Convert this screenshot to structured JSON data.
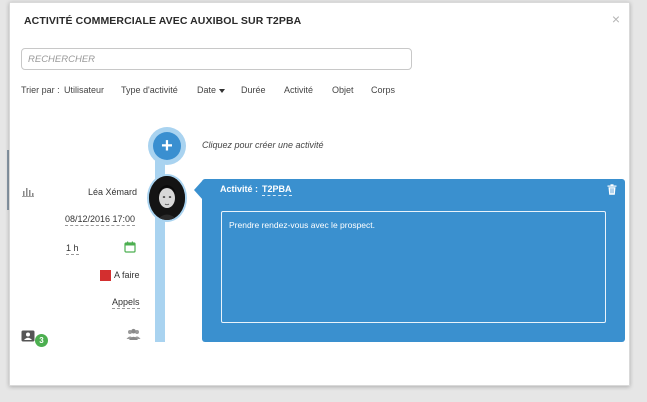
{
  "modal": {
    "title": "ACTIVITÉ COMMERCIALE AVEC AUXIBOL SUR T2PBA",
    "close_glyph": "×"
  },
  "search": {
    "placeholder": "RECHERCHER"
  },
  "sortbar": {
    "label": "Trier par :",
    "options": [
      "Utilisateur",
      "Type d'activité",
      "Date",
      "Durée",
      "Activité",
      "Objet",
      "Corps"
    ],
    "active_sort": "Date"
  },
  "timeline": {
    "add_glyph": "+",
    "add_hint": "Cliquez pour créer une activité"
  },
  "activity": {
    "user": "Léa Xémard",
    "datetime": "08/12/2016 17:00",
    "duration": "1 h",
    "status": "A faire",
    "status_color": "#d32f2f",
    "type": "Appels",
    "badge_count": "3",
    "card_label": "Activité :",
    "card_value": "T2PBA",
    "body": "Prendre rendez-vous avec le prospect.",
    "card_color": "#3a90cf",
    "timeline_color": "#a9d3f0"
  },
  "icons": {
    "close": "close-icon",
    "add": "plus-icon",
    "chart": "bar-chart-icon",
    "calendar": "calendar-icon",
    "group": "group-icon",
    "user": "user-card-icon",
    "trash": "trash-icon"
  }
}
